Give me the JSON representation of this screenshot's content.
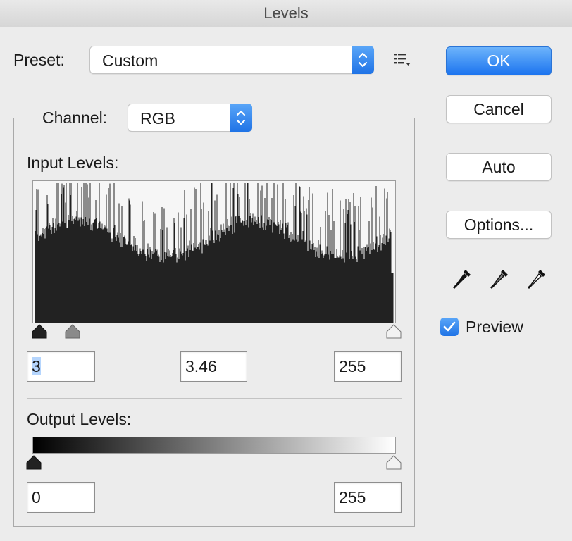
{
  "window": {
    "title": "Levels"
  },
  "preset": {
    "label": "Preset:",
    "value": "Custom"
  },
  "channel": {
    "label": "Channel:",
    "value": "RGB"
  },
  "input_levels": {
    "label": "Input Levels:",
    "black": "3",
    "gamma": "3.46",
    "white": "255"
  },
  "output_levels": {
    "label": "Output Levels:",
    "black": "0",
    "white": "255"
  },
  "buttons": {
    "ok": "OK",
    "cancel": "Cancel",
    "auto": "Auto",
    "options": "Options..."
  },
  "preview": {
    "label": "Preview",
    "checked": true
  },
  "colors": {
    "accent": "#1f73e6",
    "histogram": "#222222"
  },
  "icons": [
    "preset-options-menu-icon",
    "black-point-eyedropper-icon",
    "gray-point-eyedropper-icon",
    "white-point-eyedropper-icon"
  ]
}
